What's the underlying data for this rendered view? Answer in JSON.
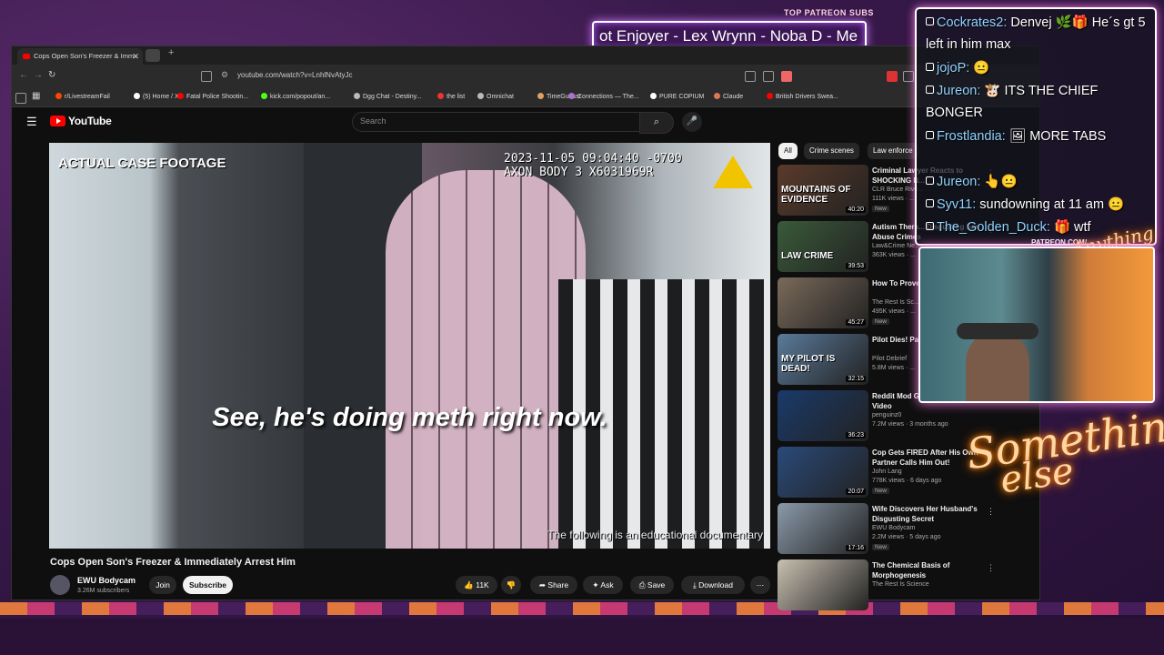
{
  "overlay": {
    "patreon_label": "TOP PATREON SUBS",
    "ticker_text": "ot Enjoyer - Lex Wrynn -  Noba D - Me",
    "patreon_url": "PATREON.COM/",
    "brand_script_top": "Anything Else",
    "brand_script_bottom_1": "Something",
    "brand_script_bottom_2": "else"
  },
  "browser": {
    "tab_title": "Cops Open Son's Freezer & Imm",
    "url": "youtube.com/watch?v=LnhlNvAtyJc",
    "bookmarks": [
      {
        "label": "r/LivestreamFail",
        "color": "#ff4500"
      },
      {
        "label": "(5) Home / X",
        "color": "#ffffff"
      },
      {
        "label": "Fatal Police Shootin...",
        "color": "#ff0000"
      },
      {
        "label": "kick.com/popout/an...",
        "color": "#53fc18"
      },
      {
        "label": "Dgg Chat - Destiny...",
        "color": "#bbbbbb"
      },
      {
        "label": "the list",
        "color": "#e33"
      },
      {
        "label": "Omnichat",
        "color": "#bbbbbb"
      },
      {
        "label": "TimeGuessr",
        "color": "#e0a060"
      },
      {
        "label": "Connections — The...",
        "color": "#b06fd0"
      },
      {
        "label": "PURE  COPIUM",
        "color": "#ffffff"
      },
      {
        "label": "Claude",
        "color": "#d97757"
      },
      {
        "label": "British Drivers Swea...",
        "color": "#ff0000"
      }
    ]
  },
  "youtube": {
    "logo": "YouTube",
    "search_placeholder": "Search",
    "video": {
      "overlay_tag": "ACTUAL CASE FOOTAGE",
      "timestamp_line1": "2023-11-05 09:04:40 -0700",
      "timestamp_line2": "AXON BODY 3  X6031969R",
      "caption": "See, he's doing meth right now.",
      "disclaimer": "The following is an educational documentary"
    },
    "title": "Cops Open Son's Freezer & Immediately Arrest Him",
    "channel": {
      "name": "EWU Bodycam",
      "subs": "3.26M subscribers"
    },
    "join_label": "Join",
    "subscribe_label": "Subscribe",
    "actions": {
      "likes": "11K",
      "share": "Share",
      "ask": "Ask",
      "save": "Save",
      "download": "Download"
    },
    "chips": [
      "All",
      "Crime scenes",
      "Law enforce"
    ],
    "recommendations": [
      {
        "title": "Criminal Lawyer Reacts to SHOCKING N...",
        "channel": "CLR Bruce Rive...",
        "meta": "111K views · ...",
        "duration": "40:20",
        "new": "New",
        "thumb_text": "MOUNTAINS OF EVIDENCE",
        "color": "#5a3a2a"
      },
      {
        "title": "Autism Thera... Disgusting Sex Abuse Crimes",
        "channel": "Law&Crime Ne...",
        "meta": "363K views · ...",
        "duration": "39:53",
        "new": "",
        "thumb_text": "LAW CRIME",
        "color": "#3a5a3a"
      },
      {
        "title": "How To Prove... Traveller",
        "channel": "The Rest Is Sc...",
        "meta": "495K views · ...",
        "duration": "45:27",
        "new": "New",
        "thumb_text": "",
        "color": "#7a6a5a"
      },
      {
        "title": "Pilot Dies! Pa... Land Plane!",
        "channel": "Pilot Debrief",
        "meta": "5.8M views · ...",
        "duration": "32:15",
        "new": "",
        "thumb_text": "MY PILOT IS DEAD!",
        "color": "#5a7a9a"
      },
      {
        "title": "Reddit Mod G... Made a Wild Video",
        "channel": "penguinz0",
        "meta": "7.2M views · 3 months ago",
        "duration": "36:23",
        "new": "",
        "thumb_text": "",
        "color": "#1a3a6a"
      },
      {
        "title": "Cop Gets FIRED After His Own Partner Calls Him Out!",
        "channel": "John Lang",
        "meta": "778K views · 6 days ago",
        "duration": "20:07",
        "new": "New",
        "thumb_text": "",
        "color": "#2a4a7a"
      },
      {
        "title": "Wife Discovers Her Husband's Disgusting Secret",
        "channel": "EWU Bodycam",
        "meta": "2.2M views · 5 days ago",
        "duration": "17:16",
        "new": "New",
        "thumb_text": "",
        "color": "#8a9aaa"
      },
      {
        "title": "The Chemical Basis of Morphogenesis",
        "channel": "The Rest Is Science",
        "meta": "",
        "duration": "",
        "new": "",
        "thumb_text": "",
        "color": "#c8c0b0"
      }
    ]
  },
  "chat": {
    "messages": [
      {
        "user": "Cockrates2:",
        "text": "Denvej 🌿🎁 He´s gt 5"
      },
      {
        "user": "",
        "text": "left in him max"
      },
      {
        "user": "jojoP:",
        "text": "😐"
      },
      {
        "user": "Jureon:",
        "text": "🐮 ITS THE CHIEF"
      },
      {
        "user": "",
        "text": "BONGER"
      },
      {
        "user": "Frostlandia:",
        "text": "🖼 MORE TABS"
      },
      {
        "user": "",
        "text": ""
      },
      {
        "user": "Jureon:",
        "text": "👆😐"
      },
      {
        "user": "Syv11:",
        "text": "sundowning at 11 am 😐"
      },
      {
        "user": "The_Golden_Duck:",
        "text": "🎁 wtf"
      }
    ]
  }
}
